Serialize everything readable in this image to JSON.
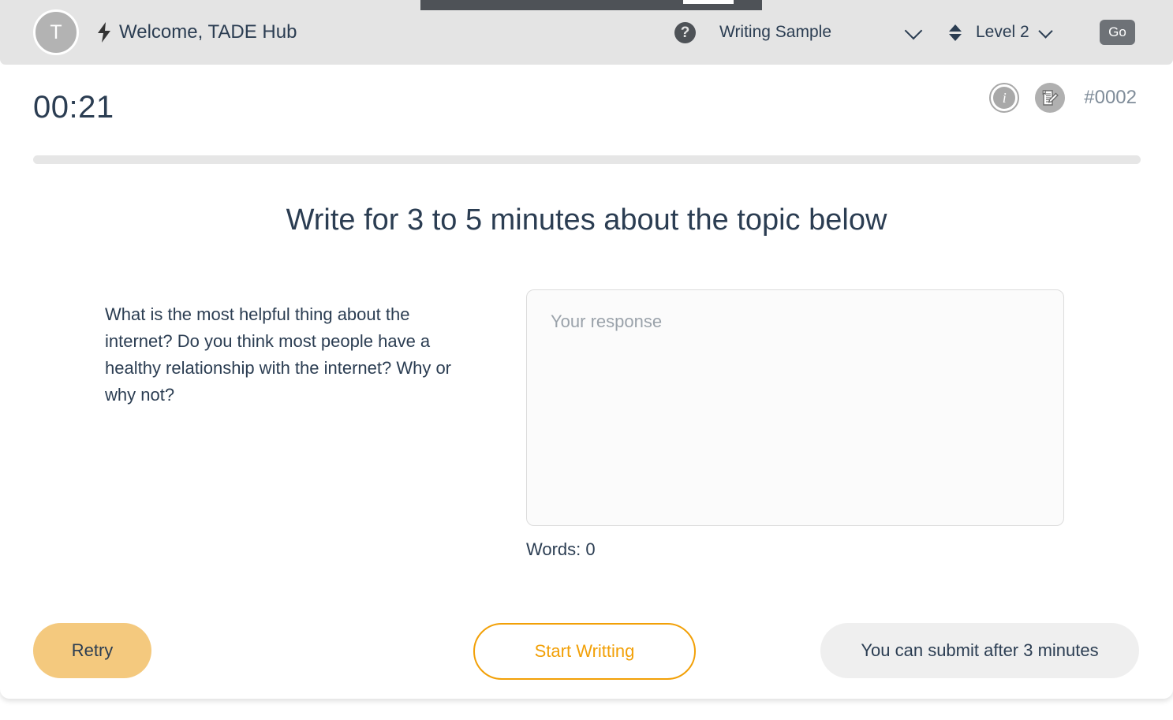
{
  "header": {
    "avatar_initial": "T",
    "bolt_icon": "bolt-icon",
    "welcome_text": "Welcome, TADE Hub",
    "help_icon_glyph": "?",
    "activity_name": "Writing Sample",
    "level_label": "Level 2",
    "go_label": "Go"
  },
  "status": {
    "timer": "00:21",
    "attempt_id": "#0002",
    "info_glyph": "i",
    "progress_percent": 0
  },
  "main": {
    "title": "Write for 3 to 5 minutes about the topic below",
    "prompt": "What is the most helpful thing about the internet? Do you think most people have a healthy relationship with the internet? Why or why not?",
    "response_value": "",
    "response_placeholder": "Your response",
    "word_count": "Words: 0"
  },
  "footer": {
    "retry_label": "Retry",
    "start_label": "Start Writting",
    "submit_label": "You can submit after 3 minutes"
  },
  "colors": {
    "header_bg": "#e4e4e4",
    "accent_orange": "#f2a007",
    "retry_bg": "#f4c97e",
    "text_primary": "#2b3d52",
    "muted": "#7f8c99",
    "overlay_dark": "#4e5257"
  }
}
